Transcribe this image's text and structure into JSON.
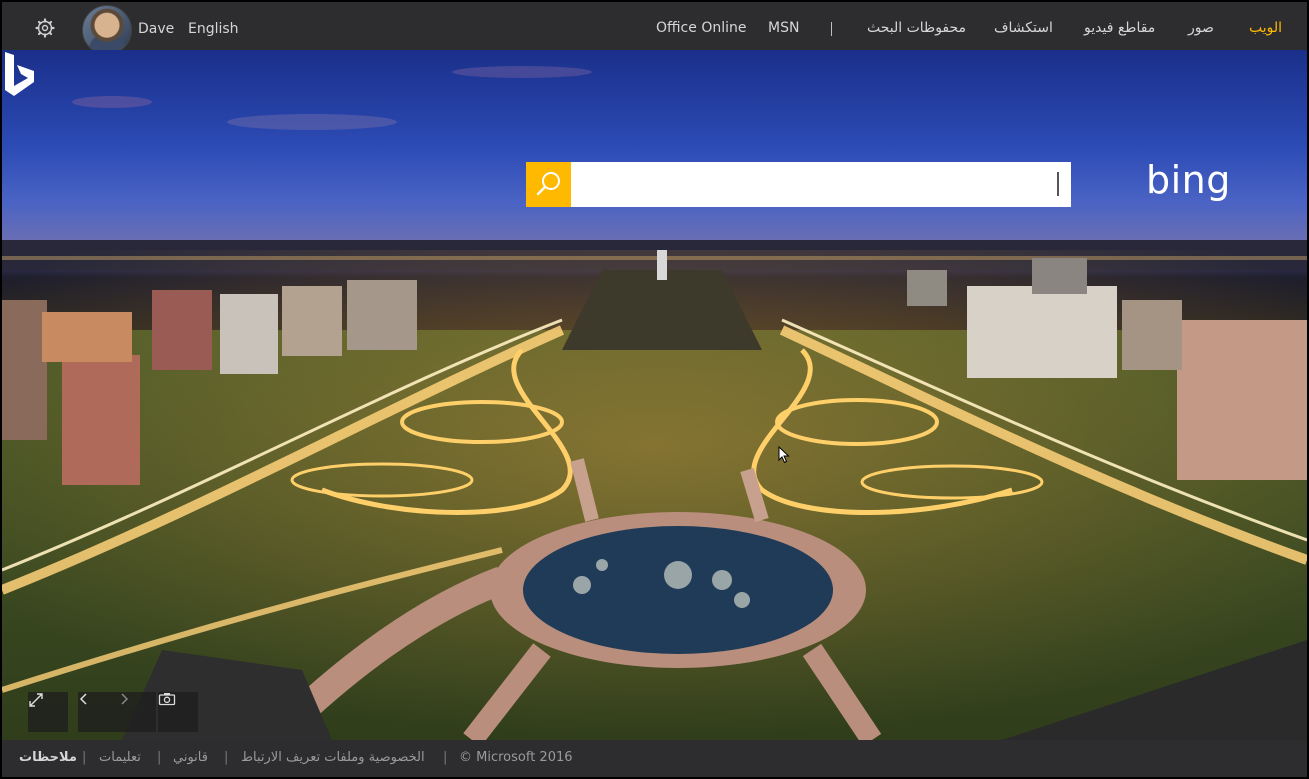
{
  "header": {
    "user_name": "Dave",
    "language": "English",
    "nav": {
      "web": "الويب",
      "images": "صور",
      "videos": "مقاطع فيديو",
      "explore": "استكشاف",
      "saved": "محفوظات البحث",
      "msn": "MSN",
      "office": "Office Online"
    }
  },
  "search": {
    "value": "",
    "placeholder": "",
    "brand": "bing"
  },
  "footer": {
    "feedback": "ملاحظات",
    "help": "تعليمات",
    "legal": "قانوني",
    "privacy": "الخصوصية وملفات تعريف الارتباط",
    "copyright": "© Microsoft 2016"
  },
  "colors": {
    "accent": "#ffb900",
    "bar": "#2d2d30"
  },
  "icons": {
    "settings": "gear-icon",
    "search": "search-icon",
    "fullscreen": "expand-icon",
    "prev": "chevron-left-icon",
    "next": "chevron-right-icon",
    "camera": "camera-icon"
  }
}
